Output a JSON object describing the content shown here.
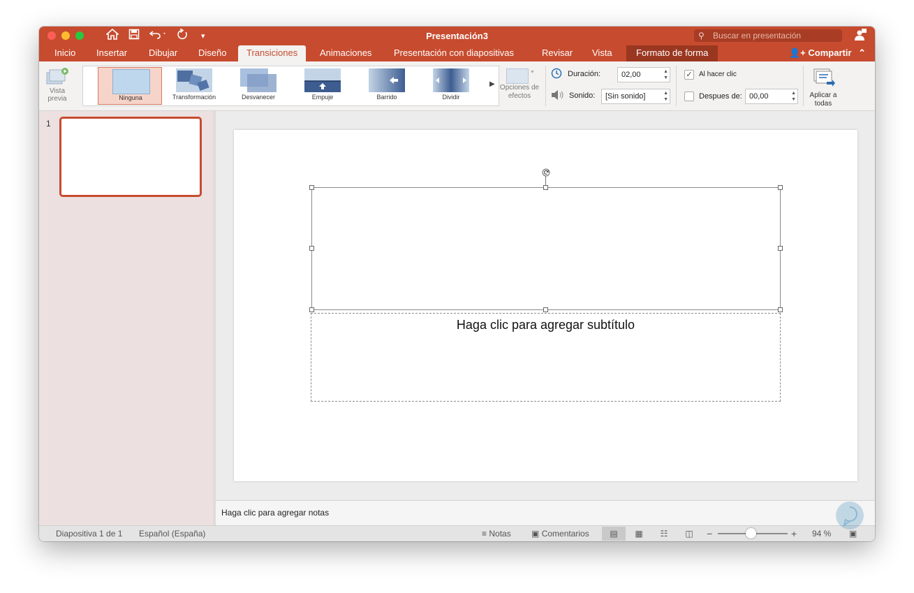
{
  "window": {
    "title": "Presentación3"
  },
  "search": {
    "placeholder": "Buscar en presentación"
  },
  "tabs": [
    {
      "label": "Inicio"
    },
    {
      "label": "Insertar"
    },
    {
      "label": "Dibujar"
    },
    {
      "label": "Diseño"
    },
    {
      "label": "Transiciones"
    },
    {
      "label": "Animaciones"
    },
    {
      "label": "Presentación con diapositivas"
    },
    {
      "label": "Revisar"
    },
    {
      "label": "Vista"
    },
    {
      "label": "Formato de forma"
    }
  ],
  "share_label": "Compartir",
  "ribbon": {
    "preview_label": "Vista previa",
    "transitions": [
      {
        "label": "Ninguna",
        "selected": true
      },
      {
        "label": "Transformación"
      },
      {
        "label": "Desvanecer"
      },
      {
        "label": "Empuje"
      },
      {
        "label": "Barrido"
      },
      {
        "label": "Dividir"
      }
    ],
    "effect_options_label": "Opciones de efectos",
    "duration_label": "Duración:",
    "duration_value": "02,00",
    "sound_label": "Sonido:",
    "sound_value": "[Sin sonido]",
    "on_click_label": "Al hacer clic",
    "on_click_checked": true,
    "after_label": "Despues de:",
    "after_value": "00,00",
    "after_checked": false,
    "apply_all_label": "Aplicar a todas"
  },
  "thumbnails": [
    {
      "number": "1"
    }
  ],
  "slide": {
    "subtitle_placeholder": "Haga clic para agregar subtítulo"
  },
  "notes": {
    "placeholder": "Haga clic para agregar notas"
  },
  "status": {
    "slide_info": "Diapositiva 1 de 1",
    "language": "Español (España)",
    "notes_label": "Notas",
    "comments_label": "Comentarios",
    "zoom_minus": "−",
    "zoom_plus": "+",
    "zoom_value": "94 %",
    "zoom_level": 0.47
  },
  "colors": {
    "accent": "#c74b2e",
    "accent_dark": "#9a3720",
    "selected_transition": "#f7d4c9"
  },
  "icons": [
    "home-icon",
    "save-icon",
    "undo-icon",
    "redo-icon",
    "customize-icon",
    "search-icon",
    "account-icon",
    "share-icon",
    "clock-icon",
    "speaker-icon",
    "apply-all-icon",
    "rotate-icon"
  ]
}
